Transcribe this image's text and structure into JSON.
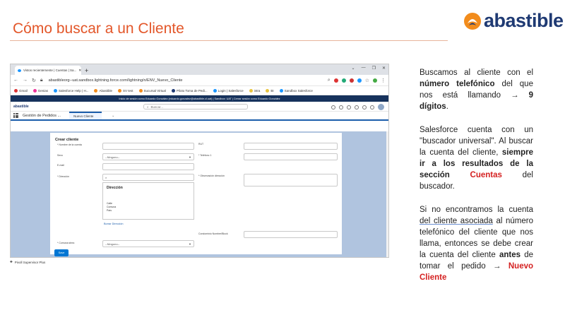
{
  "slide": {
    "title": "Cómo buscar a un Cliente",
    "logo_text": "abastible",
    "footer": "Pivoll Supervisor Plus"
  },
  "browser": {
    "tab_label": "Vistos recientemente | Cuentas | Sa...",
    "url": "abastibleorg--uat.sandbox.lightning.force.com/lightning/n/ENV_Nuevo_Cliente",
    "bookmarks": [
      "Gmail",
      "Genias",
      "Salesforce Help | H...",
      "Abastible",
      "SV test",
      "Sucursal Virtual",
      "Piloto Toma de Pedi...",
      "Login | Salesforce",
      "intra",
      "BI",
      "Sandbox Salesforce"
    ],
    "banner": "Inicio de sesión como Eduardo González (eduardo.gonzalez@abastible.cl.uat) | Sandbox: UAT | Cerrar sesión como Eduardo González"
  },
  "salesforce": {
    "logo": "abastible",
    "search_placeholder": "Buscar...",
    "app_name": "Gestión de Pedidos ...",
    "active_tab": "Nuevo Cliente"
  },
  "form": {
    "title": "Crear cliente",
    "labels": {
      "nombre": "* Nombre de la cuenta",
      "rut": "RUT",
      "sexo": "Sexo",
      "telefono": "* Teléfono 1",
      "email": "E-mail",
      "direccion": "* Dirección",
      "observacion": "* Observación dirección",
      "condominio": "Condominio Nombre/Block",
      "comuna": "* Comuna strea"
    },
    "sexo_value": "--Ninguno--",
    "comuna_value": "--Ninguno--",
    "dropdown_title": "Dirección",
    "dropdown_items": [
      "Calle",
      "Comuna",
      "País"
    ],
    "borrar_direccion": "Borrar Dirección",
    "save": "Save"
  },
  "notes": {
    "p1_a": "Buscamos al cliente con el ",
    "p1_b": "número telefónico",
    "p1_c": " del que nos está llamando ",
    "p1_arrow": "→",
    "p1_d": " 9 dígitos",
    "p1_e": ".",
    "p2_a": "Salesforce cuenta con un \"buscador universal\". Al buscar la cuenta del cliente, ",
    "p2_b": "siempre ir a los resultados de la sección",
    "p2_c": "Cuentas",
    "p2_d": " del buscador.",
    "p3_a": "Si no encontramos la cuenta ",
    "p3_u": "del cliente asociada",
    "p3_b": " al número telefónico del cliente que nos llama, entonces se debe crear la cuenta del cliente ",
    "p3_c": "antes",
    "p3_d": " de tomar el pedido ",
    "p3_arrow": "→",
    "p3_e": "Nuevo Cliente"
  },
  "colors": {
    "title_orange": "#e3572a",
    "logo_blue": "#1f3a73",
    "sf_blue": "#0176d3",
    "highlight_red": "#d42020"
  }
}
